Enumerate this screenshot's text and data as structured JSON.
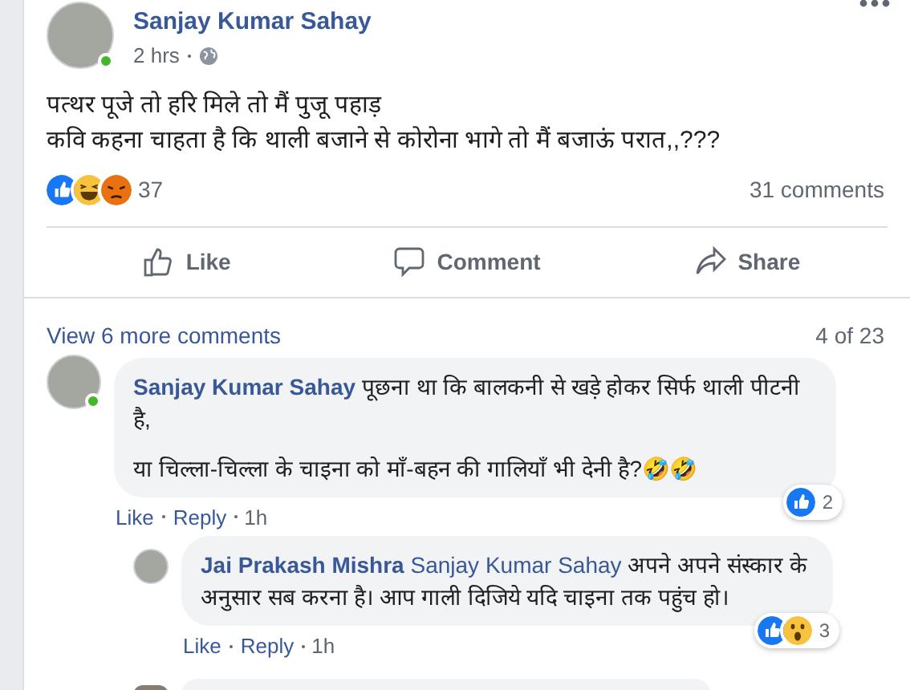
{
  "post": {
    "author": "Sanjay Kumar Sahay",
    "time": "2 hrs",
    "online": true,
    "text": [
      "पत्थर पूजे तो हरि मिले तो मैं पुजू पहाड़",
      "कवि कहना चाहता है कि थाली बजाने से कोरोना भागे तो मैं बजाऊं परात,,???"
    ],
    "reactions": [
      {
        "kind": "like"
      },
      {
        "kind": "haha"
      },
      {
        "kind": "angry"
      }
    ],
    "reaction_count": "37",
    "comment_count": "31 comments",
    "actions": [
      {
        "kind": "like",
        "label": "Like"
      },
      {
        "kind": "comment",
        "label": "Comment"
      },
      {
        "kind": "share",
        "label": "Share"
      }
    ]
  },
  "comments_header": {
    "link": "View 6 more comments",
    "count": "4 of 23"
  },
  "comments": [
    {
      "author": "Sanjay Kumar Sahay",
      "online": true,
      "text": [
        "पूछना था कि बालकनी से खड़े होकर सिर्फ थाली पीटनी है,",
        "या चिल्ला-चिल्ला के चाइना को माँ-बहन की गालियाँ भी देनी है?🤣🤣"
      ],
      "reactions": [
        {
          "kind": "like"
        }
      ],
      "reaction_count": "2",
      "actions": [
        "Like",
        "Reply"
      ],
      "time": "1h",
      "children": [
        {
          "author": "Jai Prakash Mishra",
          "mention": "Sanjay Kumar Sahay",
          "text": [
            "अपने अपने संस्कार के अनुसार सब करना है। आप गाली दिजिये यदि चाइना तक पहुंच हो।"
          ],
          "reactions": [
            {
              "kind": "like"
            },
            {
              "kind": "wow"
            }
          ],
          "reaction_count": "3",
          "actions": [
            "Like",
            "Reply"
          ],
          "time": "1h"
        }
      ]
    }
  ]
}
